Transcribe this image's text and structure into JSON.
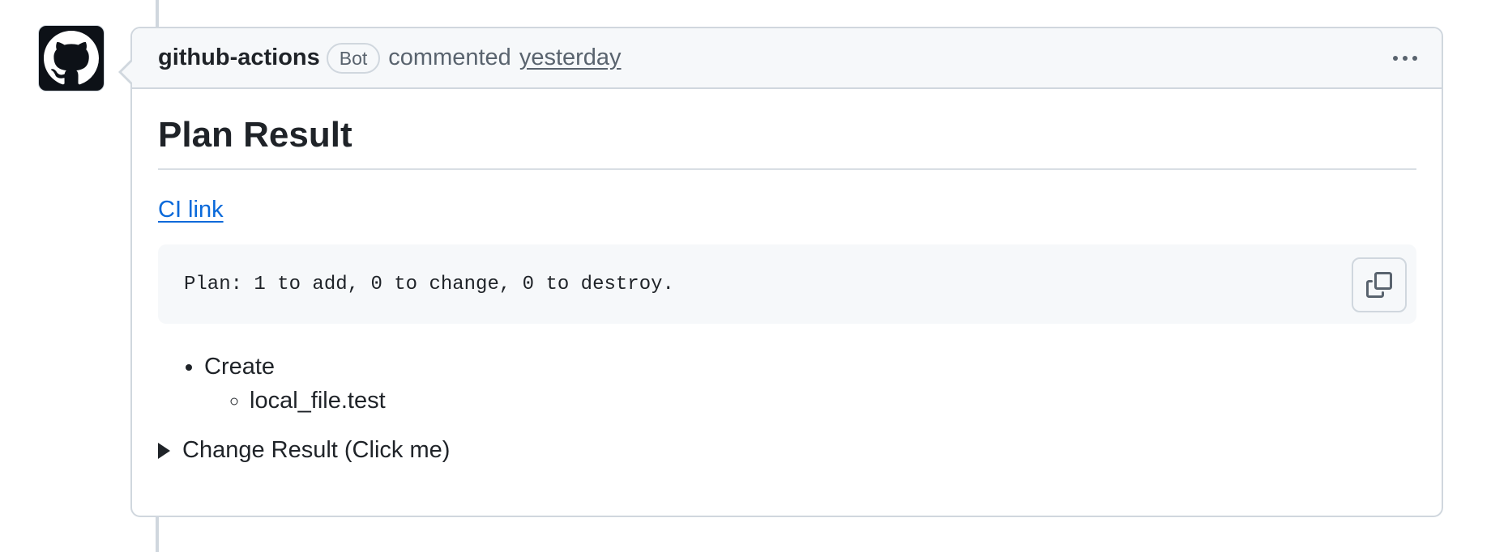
{
  "comment": {
    "author": "github-actions",
    "badge": "Bot",
    "action": "commented",
    "timestamp": "yesterday"
  },
  "body": {
    "heading": "Plan Result",
    "ci_link": "CI link",
    "code": "Plan: 1 to add, 0 to change, 0 to destroy.",
    "list": {
      "item": "Create",
      "subitem": "local_file.test"
    },
    "details_summary": "Change Result (Click me)"
  },
  "icons": {
    "avatar": "github-octocat-icon",
    "menu": "kebab-horizontal-icon",
    "copy": "copy-icon",
    "disclosure": "triangle-right-icon"
  },
  "colors": {
    "link": "#0969da",
    "border": "#d0d7de",
    "header_bg": "#f6f8fa",
    "muted_text": "#59636e"
  }
}
